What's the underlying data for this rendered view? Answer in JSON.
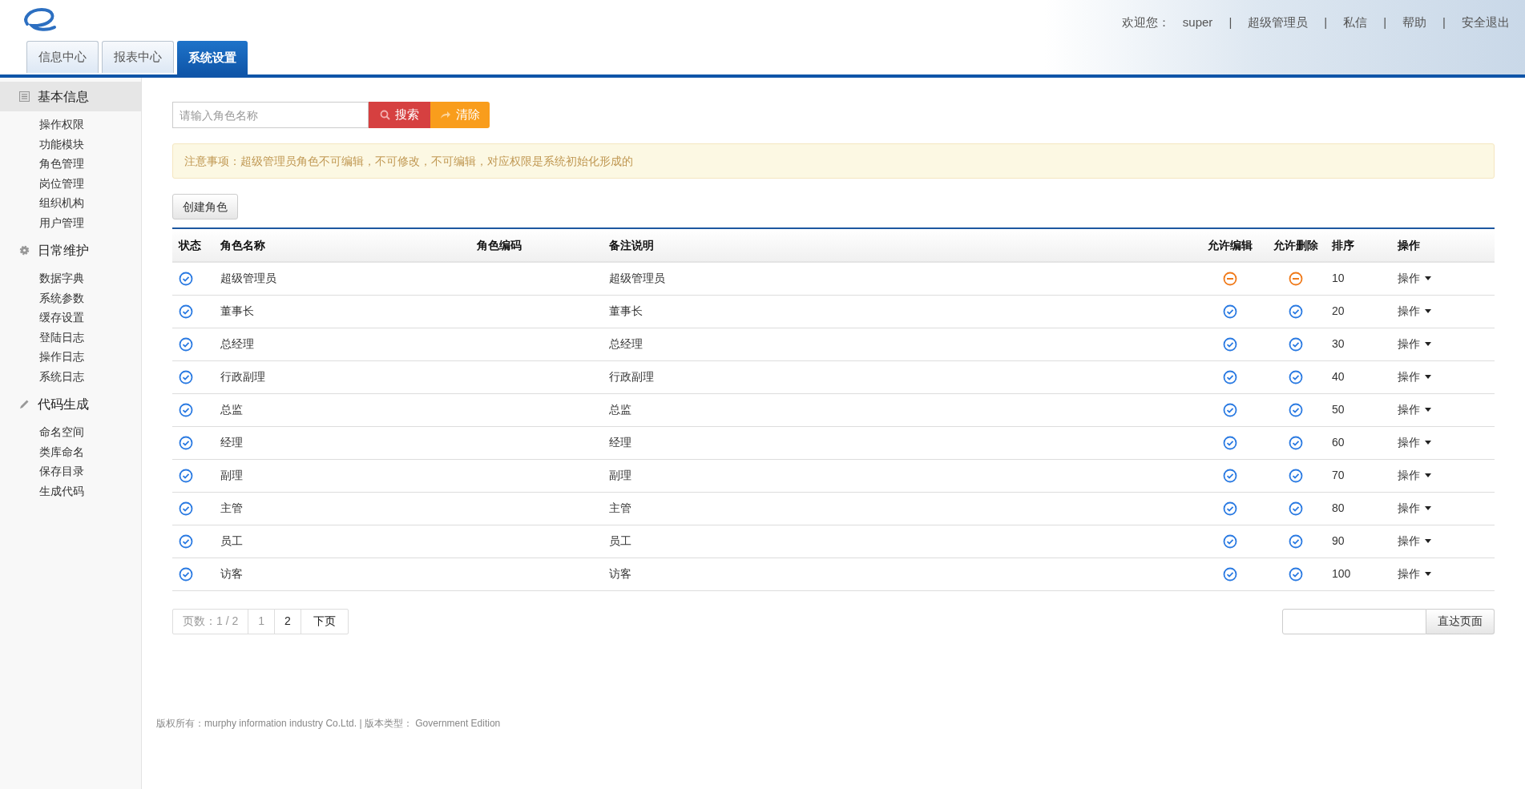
{
  "header": {
    "user_bar": [
      {
        "kind": "label",
        "text": "欢迎您："
      },
      {
        "kind": "link",
        "text": "super"
      },
      {
        "kind": "separator",
        "text": "|"
      },
      {
        "kind": "link",
        "text": "超级管理员"
      },
      {
        "kind": "separator",
        "text": "|"
      },
      {
        "kind": "link",
        "text": "私信"
      },
      {
        "kind": "separator",
        "text": "|"
      },
      {
        "kind": "link",
        "text": "帮助"
      },
      {
        "kind": "separator",
        "text": "|"
      },
      {
        "kind": "link",
        "text": "安全退出"
      }
    ]
  },
  "tabs": [
    {
      "label": "信息中心",
      "selected": false
    },
    {
      "label": "报表中心",
      "selected": false
    },
    {
      "label": "系统设置",
      "selected": true
    }
  ],
  "sidebar": {
    "groups": [
      {
        "title": "基本信息",
        "kind": "list",
        "selected": true,
        "items": [
          "操作权限",
          "功能模块",
          "角色管理",
          "岗位管理",
          "组织机构",
          "用户管理"
        ]
      },
      {
        "title": "日常维护",
        "kind": "gear",
        "selected": false,
        "items": [
          "数据字典",
          "系统参数",
          "缓存设置",
          "登陆日志",
          "操作日志",
          "系统日志"
        ]
      },
      {
        "title": "代码生成",
        "kind": "pencil",
        "selected": false,
        "items": [
          "命名空间",
          "类库命名",
          "保存目录",
          "生成代码"
        ]
      }
    ]
  },
  "search": {
    "placeholder": "请输入角色名称",
    "search_button": "搜索",
    "clear_button": "清除"
  },
  "notice": "注意事项：超级管理员角色不可编辑，不可修改，不可编辑，对应权限是系统初始化形成的",
  "create_button": "创建角色",
  "table": {
    "columns": [
      "状态",
      "角色名称",
      "角色编码",
      "备注说明",
      "允许编辑",
      "允许删除",
      "排序",
      "操作"
    ],
    "rows": [
      {
        "status": true,
        "name": "超级管理员",
        "remark": "超级管理员",
        "editable": false,
        "deletable": false,
        "order": "10",
        "action": "操作"
      },
      {
        "status": true,
        "name": "董事长",
        "remark": "董事长",
        "editable": true,
        "deletable": true,
        "order": "20",
        "action": "操作"
      },
      {
        "status": true,
        "name": "总经理",
        "remark": "总经理",
        "editable": true,
        "deletable": true,
        "order": "30",
        "action": "操作"
      },
      {
        "status": true,
        "name": "行政副理",
        "remark": "行政副理",
        "editable": true,
        "deletable": true,
        "order": "40",
        "action": "操作"
      },
      {
        "status": true,
        "name": "总监",
        "remark": "总监",
        "editable": true,
        "deletable": true,
        "order": "50",
        "action": "操作"
      },
      {
        "status": true,
        "name": "经理",
        "remark": "经理",
        "editable": true,
        "deletable": true,
        "order": "60",
        "action": "操作"
      },
      {
        "status": true,
        "name": "副理",
        "remark": "副理",
        "editable": true,
        "deletable": true,
        "order": "70",
        "action": "操作"
      },
      {
        "status": true,
        "name": "主管",
        "remark": "主管",
        "editable": true,
        "deletable": true,
        "order": "80",
        "action": "操作"
      },
      {
        "status": true,
        "name": "员工",
        "remark": "员工",
        "editable": true,
        "deletable": true,
        "order": "90",
        "action": "操作"
      },
      {
        "status": true,
        "name": "访客",
        "remark": "访客",
        "editable": true,
        "deletable": true,
        "order": "100",
        "action": "操作"
      }
    ]
  },
  "pagination": {
    "info": "页数：1 / 2",
    "pages": [
      {
        "label": "1",
        "selected": true
      },
      {
        "label": "2",
        "selected": false
      }
    ],
    "next": "下页",
    "goto_button": "直达页面"
  },
  "footer": "版权所有：murphy information industry Co.Ltd. | 版本类型： Government Edition"
}
